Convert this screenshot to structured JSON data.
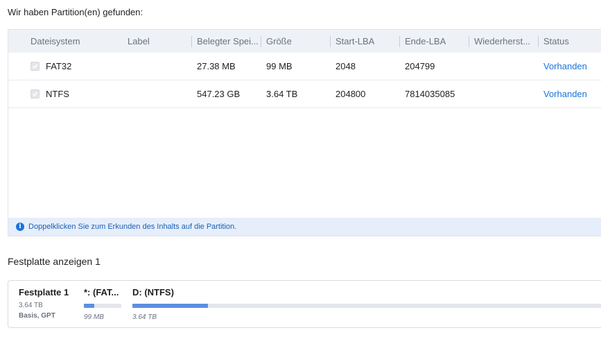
{
  "heading": "Wir haben Partition(en) gefunden:",
  "table": {
    "columns": [
      "Dateisystem",
      "Label",
      "Belegter Spei...",
      "Größe",
      "Start-LBA",
      "Ende-LBA",
      "Wiederherst...",
      "Status"
    ],
    "rows": [
      {
        "checked": true,
        "filesystem": "FAT32",
        "label": "",
        "used": "27.38 MB",
        "size": "99 MB",
        "start_lba": "2048",
        "end_lba": "204799",
        "recovery": "",
        "status": "Vorhanden"
      },
      {
        "checked": true,
        "filesystem": "NTFS",
        "label": "",
        "used": "547.23 GB",
        "size": "3.64 TB",
        "start_lba": "204800",
        "end_lba": "7814035085",
        "recovery": "",
        "status": "Vorhanden"
      }
    ]
  },
  "info": {
    "icon": "info-icon",
    "text": "Doppelklicken Sie zum Erkunden des Inhalts auf die Partition."
  },
  "disk_section_title": "Festplatte anzeigen 1",
  "disk": {
    "name": "Festplatte 1",
    "size": "3.64 TB",
    "type": "Basis, GPT",
    "partitions": [
      {
        "label": "*: (FAT...",
        "size": "99 MB",
        "fill": 0.28
      },
      {
        "label": "D: (NTFS)",
        "size": "3.64 TB",
        "fill": 0.16
      }
    ]
  },
  "colors": {
    "accent": "#1a73d9",
    "header_bg": "#eef1f6",
    "info_bg": "#e6eefb",
    "bar_fill": "#5b8fe0"
  }
}
